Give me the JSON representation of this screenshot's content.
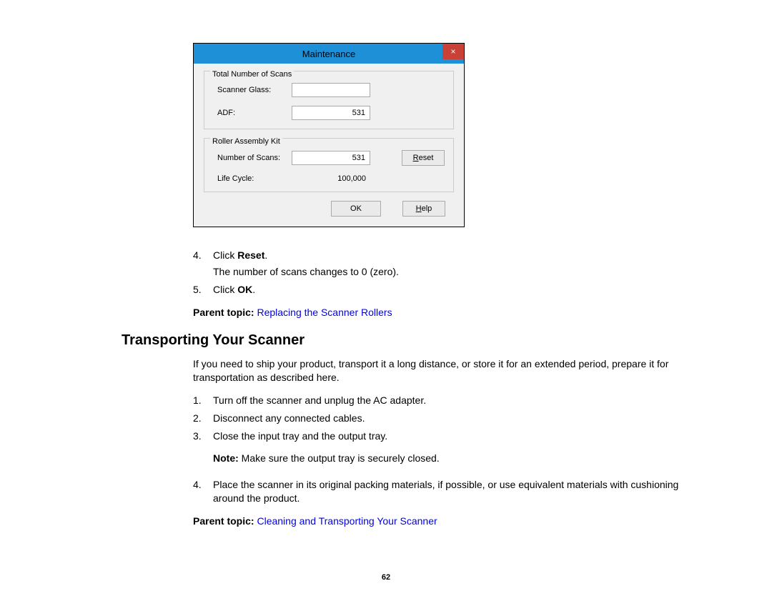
{
  "dialog": {
    "title": "Maintenance",
    "close_symbol": "×",
    "group_total": {
      "legend": "Total Number of Scans",
      "scanner_glass_label": "Scanner Glass:",
      "scanner_glass_value": "",
      "adf_label": "ADF:",
      "adf_value": "531"
    },
    "group_roller": {
      "legend": "Roller Assembly Kit",
      "num_scans_label": "Number of Scans:",
      "num_scans_value": "531",
      "reset_prefix": "R",
      "reset_rest": "eset",
      "life_cycle_label": "Life Cycle:",
      "life_cycle_value": "100,000"
    },
    "ok_label": "OK",
    "help_prefix": "H",
    "help_rest": "elp"
  },
  "steps_first": {
    "s4_num": "4.",
    "s4_main": "Click ",
    "s4_bold": "Reset",
    "s4_end": ".",
    "s4_sub": "The number of scans changes to 0 (zero).",
    "s5_num": "5.",
    "s5_main": "Click ",
    "s5_bold": "OK",
    "s5_end": "."
  },
  "parent1": {
    "label": "Parent topic: ",
    "link": "Replacing the Scanner Rollers"
  },
  "section": {
    "heading": "Transporting Your Scanner",
    "intro": "If you need to ship your product, transport it a long distance, or store it for an extended period, prepare it for transportation as described here.",
    "s1_num": "1.",
    "s1_text": "Turn off the scanner and unplug the AC adapter.",
    "s2_num": "2.",
    "s2_text": "Disconnect any connected cables.",
    "s3_num": "3.",
    "s3_text": "Close the input tray and the output tray.",
    "note_bold": "Note: ",
    "note_text": "Make sure the output tray is securely closed.",
    "s4_num": "4.",
    "s4_text": "Place the scanner in its original packing materials, if possible, or use equivalent materials with cushioning around the product."
  },
  "parent2": {
    "label": "Parent topic: ",
    "link": "Cleaning and Transporting Your Scanner"
  },
  "page_number": "62"
}
